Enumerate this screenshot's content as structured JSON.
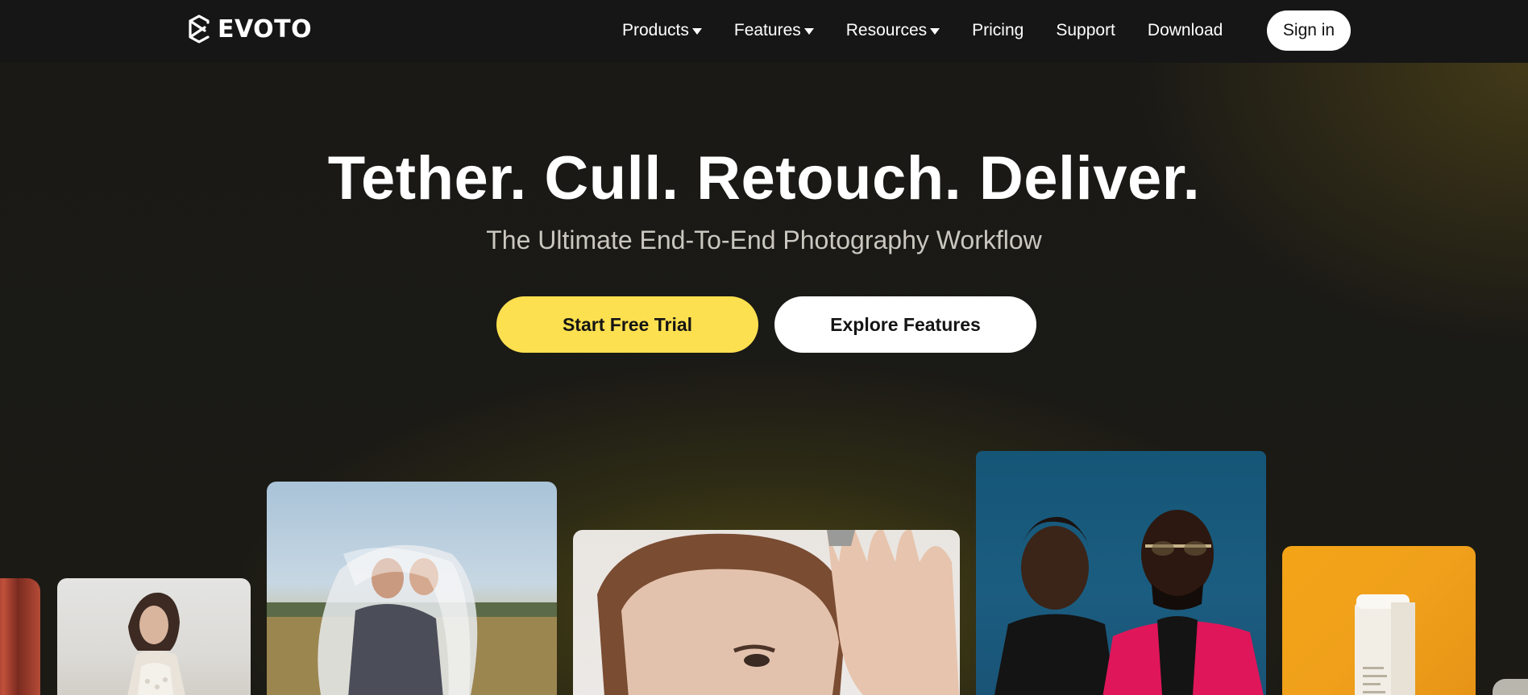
{
  "brand": {
    "name": "EVOTO",
    "logo_icon": "evoto-logo-icon"
  },
  "nav": {
    "items": [
      {
        "label": "Products",
        "has_dropdown": true
      },
      {
        "label": "Features",
        "has_dropdown": true
      },
      {
        "label": "Resources",
        "has_dropdown": true
      },
      {
        "label": "Pricing",
        "has_dropdown": false
      },
      {
        "label": "Support",
        "has_dropdown": false
      },
      {
        "label": "Download",
        "has_dropdown": false
      }
    ],
    "signin_label": "Sign in"
  },
  "hero": {
    "title": "Tether. Cull. Retouch. Deliver.",
    "subtitle": "The Ultimate End-To-End Photography Workflow",
    "primary_cta": "Start Free Trial",
    "secondary_cta": "Explore Features"
  },
  "colors": {
    "accent_yellow": "#fde04f",
    "header_bg": "#161616",
    "page_bg": "#1a1916"
  }
}
